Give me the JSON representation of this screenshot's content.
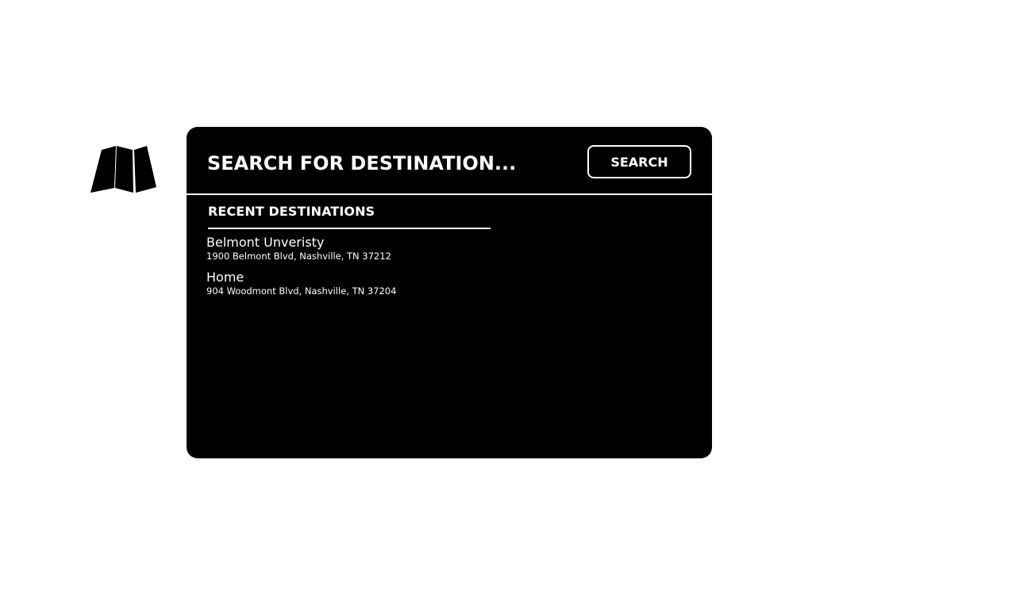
{
  "app": {
    "logo_icon": "folded-map-icon"
  },
  "search": {
    "placeholder": "SEARCH FOR DESTINATION...",
    "value": "",
    "button_label": "SEARCH"
  },
  "recent": {
    "heading": "RECENT DESTINATIONS",
    "items": [
      {
        "name": "Belmont Unveristy",
        "address": "1900 Belmont Blvd, Nashville, TN 37212"
      },
      {
        "name": "Home",
        "address": "904 Woodmont Blvd, Nashville, TN 37204"
      }
    ]
  },
  "colors": {
    "panel_background": "#000000",
    "foreground": "#ffffff",
    "page_background": "#ffffff"
  }
}
